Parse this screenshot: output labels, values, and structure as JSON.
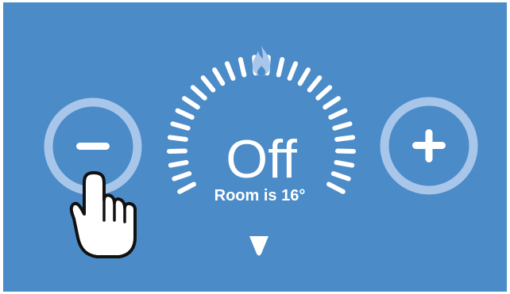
{
  "thermostat": {
    "mode_text": "Off",
    "room_text": "Room is 16°",
    "flame_icon": "flame-icon",
    "decrease_icon": "minus-icon",
    "increase_icon": "plus-icon",
    "pointer_icon": "hand-pointer-icon",
    "colors": {
      "background": "#4a8bc8",
      "tick_active": "#ffffff",
      "tick_inactive": "#a8c6ea",
      "button_ring": "#a8c6ea",
      "text": "#ffffff"
    }
  }
}
